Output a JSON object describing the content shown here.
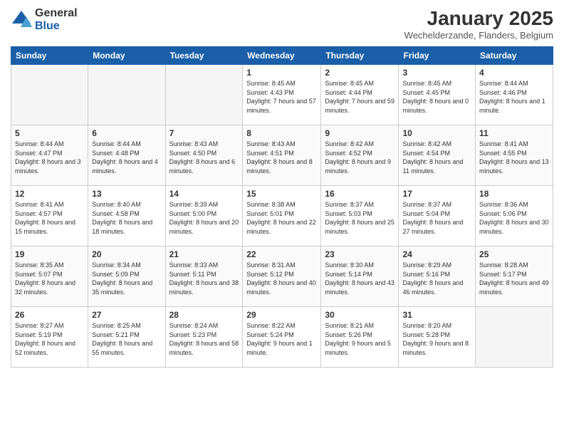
{
  "logo": {
    "general": "General",
    "blue": "Blue"
  },
  "title": {
    "month": "January 2025",
    "location": "Wechelderzande, Flanders, Belgium"
  },
  "headers": [
    "Sunday",
    "Monday",
    "Tuesday",
    "Wednesday",
    "Thursday",
    "Friday",
    "Saturday"
  ],
  "weeks": [
    [
      {
        "day": "",
        "info": ""
      },
      {
        "day": "",
        "info": ""
      },
      {
        "day": "",
        "info": ""
      },
      {
        "day": "1",
        "info": "Sunrise: 8:45 AM\nSunset: 4:43 PM\nDaylight: 7 hours and 57 minutes."
      },
      {
        "day": "2",
        "info": "Sunrise: 8:45 AM\nSunset: 4:44 PM\nDaylight: 7 hours and 59 minutes."
      },
      {
        "day": "3",
        "info": "Sunrise: 8:45 AM\nSunset: 4:45 PM\nDaylight: 8 hours and 0 minutes."
      },
      {
        "day": "4",
        "info": "Sunrise: 8:44 AM\nSunset: 4:46 PM\nDaylight: 8 hours and 1 minute."
      }
    ],
    [
      {
        "day": "5",
        "info": "Sunrise: 8:44 AM\nSunset: 4:47 PM\nDaylight: 8 hours and 3 minutes."
      },
      {
        "day": "6",
        "info": "Sunrise: 8:44 AM\nSunset: 4:48 PM\nDaylight: 8 hours and 4 minutes."
      },
      {
        "day": "7",
        "info": "Sunrise: 8:43 AM\nSunset: 4:50 PM\nDaylight: 8 hours and 6 minutes."
      },
      {
        "day": "8",
        "info": "Sunrise: 8:43 AM\nSunset: 4:51 PM\nDaylight: 8 hours and 8 minutes."
      },
      {
        "day": "9",
        "info": "Sunrise: 8:42 AM\nSunset: 4:52 PM\nDaylight: 8 hours and 9 minutes."
      },
      {
        "day": "10",
        "info": "Sunrise: 8:42 AM\nSunset: 4:54 PM\nDaylight: 8 hours and 11 minutes."
      },
      {
        "day": "11",
        "info": "Sunrise: 8:41 AM\nSunset: 4:55 PM\nDaylight: 8 hours and 13 minutes."
      }
    ],
    [
      {
        "day": "12",
        "info": "Sunrise: 8:41 AM\nSunset: 4:57 PM\nDaylight: 8 hours and 15 minutes."
      },
      {
        "day": "13",
        "info": "Sunrise: 8:40 AM\nSunset: 4:58 PM\nDaylight: 8 hours and 18 minutes."
      },
      {
        "day": "14",
        "info": "Sunrise: 8:39 AM\nSunset: 5:00 PM\nDaylight: 8 hours and 20 minutes."
      },
      {
        "day": "15",
        "info": "Sunrise: 8:38 AM\nSunset: 5:01 PM\nDaylight: 8 hours and 22 minutes."
      },
      {
        "day": "16",
        "info": "Sunrise: 8:37 AM\nSunset: 5:03 PM\nDaylight: 8 hours and 25 minutes."
      },
      {
        "day": "17",
        "info": "Sunrise: 8:37 AM\nSunset: 5:04 PM\nDaylight: 8 hours and 27 minutes."
      },
      {
        "day": "18",
        "info": "Sunrise: 8:36 AM\nSunset: 5:06 PM\nDaylight: 8 hours and 30 minutes."
      }
    ],
    [
      {
        "day": "19",
        "info": "Sunrise: 8:35 AM\nSunset: 5:07 PM\nDaylight: 8 hours and 32 minutes."
      },
      {
        "day": "20",
        "info": "Sunrise: 8:34 AM\nSunset: 5:09 PM\nDaylight: 8 hours and 35 minutes."
      },
      {
        "day": "21",
        "info": "Sunrise: 8:33 AM\nSunset: 5:11 PM\nDaylight: 8 hours and 38 minutes."
      },
      {
        "day": "22",
        "info": "Sunrise: 8:31 AM\nSunset: 5:12 PM\nDaylight: 8 hours and 40 minutes."
      },
      {
        "day": "23",
        "info": "Sunrise: 8:30 AM\nSunset: 5:14 PM\nDaylight: 8 hours and 43 minutes."
      },
      {
        "day": "24",
        "info": "Sunrise: 8:29 AM\nSunset: 5:16 PM\nDaylight: 8 hours and 46 minutes."
      },
      {
        "day": "25",
        "info": "Sunrise: 8:28 AM\nSunset: 5:17 PM\nDaylight: 8 hours and 49 minutes."
      }
    ],
    [
      {
        "day": "26",
        "info": "Sunrise: 8:27 AM\nSunset: 5:19 PM\nDaylight: 8 hours and 52 minutes."
      },
      {
        "day": "27",
        "info": "Sunrise: 8:25 AM\nSunset: 5:21 PM\nDaylight: 8 hours and 55 minutes."
      },
      {
        "day": "28",
        "info": "Sunrise: 8:24 AM\nSunset: 5:23 PM\nDaylight: 8 hours and 58 minutes."
      },
      {
        "day": "29",
        "info": "Sunrise: 8:22 AM\nSunset: 5:24 PM\nDaylight: 9 hours and 1 minute."
      },
      {
        "day": "30",
        "info": "Sunrise: 8:21 AM\nSunset: 5:26 PM\nDaylight: 9 hours and 5 minutes."
      },
      {
        "day": "31",
        "info": "Sunrise: 8:20 AM\nSunset: 5:28 PM\nDaylight: 9 hours and 8 minutes."
      },
      {
        "day": "",
        "info": ""
      }
    ]
  ]
}
